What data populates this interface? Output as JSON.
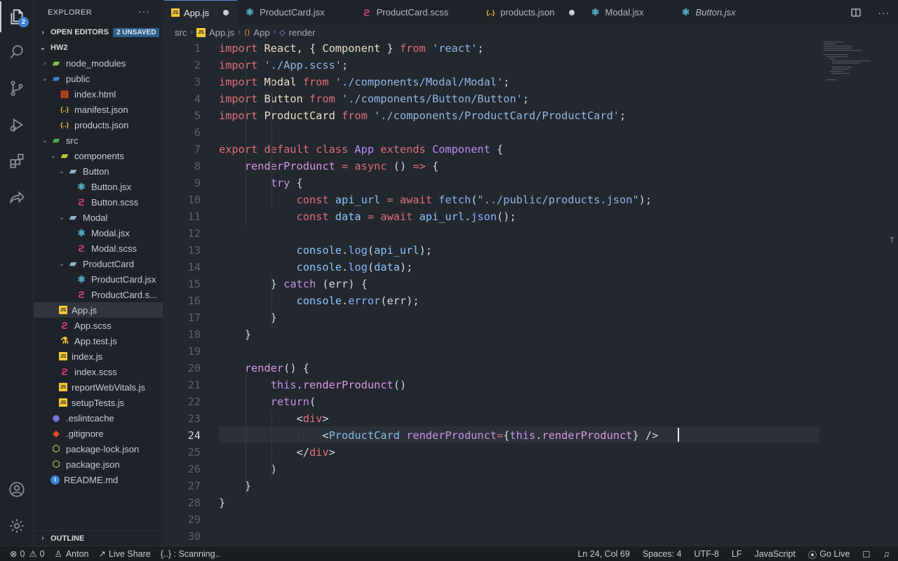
{
  "explorer": {
    "title": "EXPLORER",
    "more": "···",
    "open_editors": "OPEN EDITORS",
    "unsaved_badge": "2 UNSAVED",
    "root": "HW2",
    "outline": "OUTLINE",
    "tree": [
      {
        "label": "node_modules",
        "kind": "folder-node",
        "chev": "›",
        "indent": 1
      },
      {
        "label": "public",
        "kind": "folder-public",
        "chev": "⌄",
        "indent": 1
      },
      {
        "label": "index.html",
        "kind": "html",
        "chev": "",
        "indent": 2
      },
      {
        "label": "manifest.json",
        "kind": "json",
        "chev": "",
        "indent": 2
      },
      {
        "label": "products.json",
        "kind": "json",
        "chev": "",
        "indent": 2
      },
      {
        "label": "src",
        "kind": "folder-src",
        "chev": "⌄",
        "indent": 1
      },
      {
        "label": "components",
        "kind": "folder-comp",
        "chev": "⌄",
        "indent": 2
      },
      {
        "label": "Button",
        "kind": "folder",
        "chev": "⌄",
        "indent": 3
      },
      {
        "label": "Button.jsx",
        "kind": "react",
        "chev": "",
        "indent": 4
      },
      {
        "label": "Button.scss",
        "kind": "scss",
        "chev": "",
        "indent": 4
      },
      {
        "label": "Modal",
        "kind": "folder",
        "chev": "⌄",
        "indent": 3
      },
      {
        "label": "Modal.jsx",
        "kind": "react",
        "chev": "",
        "indent": 4
      },
      {
        "label": "Modal.scss",
        "kind": "scss",
        "chev": "",
        "indent": 4
      },
      {
        "label": "ProductCard",
        "kind": "folder",
        "chev": "⌄",
        "indent": 3
      },
      {
        "label": "ProductCard.jsx",
        "kind": "react",
        "chev": "",
        "indent": 4
      },
      {
        "label": "ProductCard.s...",
        "kind": "scss",
        "chev": "",
        "indent": 4
      },
      {
        "label": "App.js",
        "kind": "js",
        "chev": "",
        "indent": 2,
        "selected": true
      },
      {
        "label": "App.scss",
        "kind": "scss",
        "chev": "",
        "indent": 2
      },
      {
        "label": "App.test.js",
        "kind": "test",
        "chev": "",
        "indent": 2
      },
      {
        "label": "index.js",
        "kind": "js",
        "chev": "",
        "indent": 2
      },
      {
        "label": "index.scss",
        "kind": "scss",
        "chev": "",
        "indent": 2
      },
      {
        "label": "reportWebVitals.js",
        "kind": "js",
        "chev": "",
        "indent": 2
      },
      {
        "label": "setupTests.js",
        "kind": "js",
        "chev": "",
        "indent": 2
      },
      {
        "label": ".eslintcache",
        "kind": "cache",
        "chev": "",
        "indent": 1
      },
      {
        "label": ".gitignore",
        "kind": "git",
        "chev": "",
        "indent": 1
      },
      {
        "label": "package-lock.json",
        "kind": "npm",
        "chev": "",
        "indent": 1
      },
      {
        "label": "package.json",
        "kind": "npm",
        "chev": "",
        "indent": 1
      },
      {
        "label": "README.md",
        "kind": "info",
        "chev": "",
        "indent": 1
      }
    ]
  },
  "activity": {
    "badge": "2"
  },
  "tabs": [
    {
      "label": "App.js",
      "kind": "js",
      "active": true,
      "dirty": true
    },
    {
      "label": "ProductCard.jsx",
      "kind": "react",
      "active": false,
      "dirty": false
    },
    {
      "label": "ProductCard.scss",
      "kind": "scss",
      "active": false,
      "dirty": false
    },
    {
      "label": "products.json",
      "kind": "json",
      "active": false,
      "dirty": true
    },
    {
      "label": "Modal.jsx",
      "kind": "react",
      "active": false,
      "dirty": false
    },
    {
      "label": "Button.jsx",
      "kind": "react",
      "active": false,
      "dirty": false,
      "italic": true
    }
  ],
  "breadcrumb": {
    "part1": "src",
    "part2": "App.js",
    "part3": "App",
    "part4": "render"
  },
  "editor": {
    "current_line": 24,
    "line_numbers": [
      "1",
      "2",
      "3",
      "4",
      "5",
      "6",
      "7",
      "8",
      "9",
      "10",
      "11",
      "12",
      "13",
      "14",
      "15",
      "16",
      "17",
      "18",
      "19",
      "20",
      "21",
      "22",
      "23",
      "24",
      "25",
      "26",
      "27",
      "28",
      "29",
      "30"
    ],
    "lines": [
      [
        [
          "kw",
          "import"
        ],
        [
          "cls",
          " React, { Component } "
        ],
        [
          "kw",
          "from"
        ],
        [
          "str",
          " 'react'"
        ],
        [
          "punc",
          ";"
        ]
      ],
      [
        [
          "kw",
          "import"
        ],
        [
          "str",
          " './App.scss'"
        ],
        [
          "punc",
          ";"
        ]
      ],
      [
        [
          "kw",
          "import"
        ],
        [
          "cls",
          " Modal "
        ],
        [
          "kw",
          "from"
        ],
        [
          "str",
          " './components/Modal/Modal'"
        ],
        [
          "punc",
          ";"
        ]
      ],
      [
        [
          "kw",
          "import"
        ],
        [
          "cls",
          " Button "
        ],
        [
          "kw",
          "from"
        ],
        [
          "str",
          " './components/Button/Button'"
        ],
        [
          "punc",
          ";"
        ]
      ],
      [
        [
          "kw",
          "import"
        ],
        [
          "cls",
          " ProductCard "
        ],
        [
          "kw",
          "from"
        ],
        [
          "str",
          " './components/ProductCard/ProductCard'"
        ],
        [
          "punc",
          ";"
        ]
      ],
      [],
      [
        [
          "kw",
          "export default class "
        ],
        [
          "meth",
          "App "
        ],
        [
          "kw",
          "extends "
        ],
        [
          "meth",
          "Component"
        ],
        [
          "punc",
          " {"
        ]
      ],
      [
        [
          "punc",
          "    "
        ],
        [
          "mname",
          "renderProdunct"
        ],
        [
          "kw",
          " = async "
        ],
        [
          "punc",
          "() "
        ],
        [
          "kw",
          "=>"
        ],
        [
          "punc",
          " {"
        ]
      ],
      [
        [
          "punc",
          "        "
        ],
        [
          "ctl",
          "try"
        ],
        [
          "punc",
          " {"
        ]
      ],
      [
        [
          "punc",
          "            "
        ],
        [
          "kw",
          "const "
        ],
        [
          "var",
          "api_url"
        ],
        [
          "kw",
          " = await "
        ],
        [
          "fn",
          "fetch"
        ],
        [
          "punc",
          "("
        ],
        [
          "str",
          "\"../public/products.json\""
        ],
        [
          "punc",
          ");"
        ]
      ],
      [
        [
          "punc",
          "            "
        ],
        [
          "kw",
          "const "
        ],
        [
          "var",
          "data"
        ],
        [
          "kw",
          " = await "
        ],
        [
          "var",
          "api_url"
        ],
        [
          "punc",
          "."
        ],
        [
          "fn",
          "json"
        ],
        [
          "punc",
          "();"
        ]
      ],
      [],
      [
        [
          "punc",
          "            "
        ],
        [
          "var",
          "console"
        ],
        [
          "punc",
          "."
        ],
        [
          "fn",
          "log"
        ],
        [
          "punc",
          "("
        ],
        [
          "var",
          "api_url"
        ],
        [
          "punc",
          ");"
        ]
      ],
      [
        [
          "punc",
          "            "
        ],
        [
          "var",
          "console"
        ],
        [
          "punc",
          "."
        ],
        [
          "fn",
          "log"
        ],
        [
          "punc",
          "("
        ],
        [
          "var",
          "data"
        ],
        [
          "punc",
          ");"
        ]
      ],
      [
        [
          "punc",
          "        } "
        ],
        [
          "ctl",
          "catch"
        ],
        [
          "punc",
          " (err) {"
        ]
      ],
      [
        [
          "punc",
          "            "
        ],
        [
          "var",
          "console"
        ],
        [
          "punc",
          "."
        ],
        [
          "fn",
          "error"
        ],
        [
          "punc",
          "(err);"
        ]
      ],
      [
        [
          "punc",
          "        }"
        ]
      ],
      [
        [
          "punc",
          "    }"
        ]
      ],
      [],
      [
        [
          "punc",
          "    "
        ],
        [
          "mname",
          "render"
        ],
        [
          "punc",
          "() {"
        ]
      ],
      [
        [
          "punc",
          "        "
        ],
        [
          "ctl",
          "this"
        ],
        [
          "punc",
          "."
        ],
        [
          "mname",
          "renderProdunct"
        ],
        [
          "punc",
          "()"
        ]
      ],
      [
        [
          "punc",
          "        "
        ],
        [
          "ctl",
          "return"
        ],
        [
          "punc",
          "("
        ]
      ],
      [
        [
          "punc",
          "            <"
        ],
        [
          "kw",
          "div"
        ],
        [
          "punc",
          ">"
        ]
      ],
      [
        [
          "punc",
          "                <"
        ],
        [
          "tag",
          "ProductCard"
        ],
        [
          "attr",
          " renderProdunct"
        ],
        [
          "kw",
          "="
        ],
        [
          "punc",
          "{"
        ],
        [
          "ctl",
          "this"
        ],
        [
          "punc",
          "."
        ],
        [
          "mname",
          "renderProdunct"
        ],
        [
          "punc",
          "} />"
        ]
      ],
      [
        [
          "punc",
          "            </"
        ],
        [
          "kw",
          "div"
        ],
        [
          "punc",
          ">"
        ]
      ],
      [
        [
          "punc",
          "        )"
        ]
      ],
      [
        [
          "punc",
          "    }"
        ]
      ],
      [
        [
          "punc",
          "}"
        ]
      ],
      [],
      []
    ]
  },
  "status": {
    "errors": "0",
    "warnings": "0",
    "user": "Anton",
    "live_share": "Live Share",
    "scanning": "{..} : Scanning..",
    "position": "Ln 24, Col 69",
    "spaces": "Spaces: 4",
    "encoding": "UTF-8",
    "eol": "LF",
    "language": "JavaScript",
    "go_live": "Go Live"
  },
  "colors": {
    "accent": "#3b82d6",
    "react": "#5ec9e8",
    "scss": "#d6457b",
    "js": "#f1c83b",
    "json": "#f1c83b"
  }
}
